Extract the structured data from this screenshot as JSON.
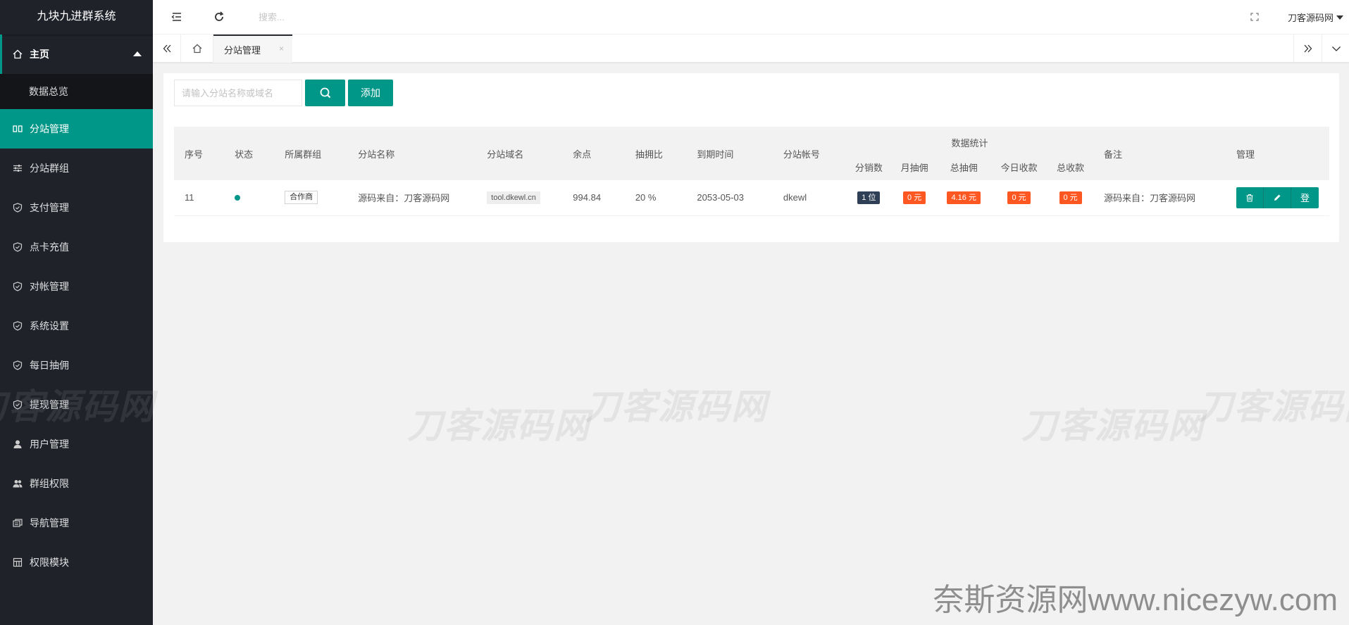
{
  "app": {
    "title": "九块九进群系统"
  },
  "sidebar": {
    "home": {
      "label": "主页",
      "icon": "home-icon"
    },
    "home_sub": [
      "数据总览"
    ],
    "items": [
      {
        "label": "分站管理",
        "icon": "columns-icon",
        "active": true
      },
      {
        "label": "分站群组",
        "icon": "sliders-icon"
      },
      {
        "label": "支付管理",
        "icon": "shield-check-icon"
      },
      {
        "label": "点卡充值",
        "icon": "shield-check-icon"
      },
      {
        "label": "对帐管理",
        "icon": "shield-check-icon"
      },
      {
        "label": "系统设置",
        "icon": "shield-check-icon"
      },
      {
        "label": "每日抽佣",
        "icon": "shield-check-icon"
      },
      {
        "label": "提现管理",
        "icon": "shield-check-icon"
      },
      {
        "label": "用户管理",
        "icon": "user-icon"
      },
      {
        "label": "群组权限",
        "icon": "users-icon"
      },
      {
        "label": "导航管理",
        "icon": "nav-icon"
      },
      {
        "label": "权限模块",
        "icon": "grid-icon"
      }
    ]
  },
  "header": {
    "search_placeholder": "搜索...",
    "user": "刀客源码网"
  },
  "tabs": {
    "active": "分站管理",
    "close": "×"
  },
  "toolbar": {
    "keyword_placeholder": "请输入分站名称或域名",
    "add_label": "添加"
  },
  "table": {
    "group_header": "数据统计",
    "headers": {
      "index": "序号",
      "status": "状态",
      "group": "所属群组",
      "name": "分站名称",
      "domain": "分站域名",
      "balance": "余点",
      "ratio": "抽拥比",
      "expire": "到期时间",
      "account": "分站帐号",
      "remark": "备注",
      "manage": "管理"
    },
    "sub_headers": [
      "分销数",
      "月抽佣",
      "总抽佣",
      "今日收款",
      "总收款"
    ],
    "rows": [
      {
        "index": "11",
        "status_color": "#009688",
        "group": "合作商",
        "name": "源码来自：刀客源码网",
        "domain": "tool.dkewl.cn",
        "balance": "994.84",
        "ratio": "20 %",
        "expire": "2053-05-03",
        "account": "dkewl",
        "stats": [
          "1 位",
          "0 元",
          "4.16 元",
          "0 元",
          "0 元"
        ],
        "remark": "源码来自：刀客源码网",
        "login_label": "登"
      }
    ]
  },
  "watermark": {
    "text": "刀客源码网",
    "footer": "奈斯资源网www.nicezyw.com"
  },
  "colors": {
    "accent": "#009688",
    "sidebar": "#20222a",
    "badge_dark": "#2f4056",
    "badge_orange": "#ff5722"
  }
}
